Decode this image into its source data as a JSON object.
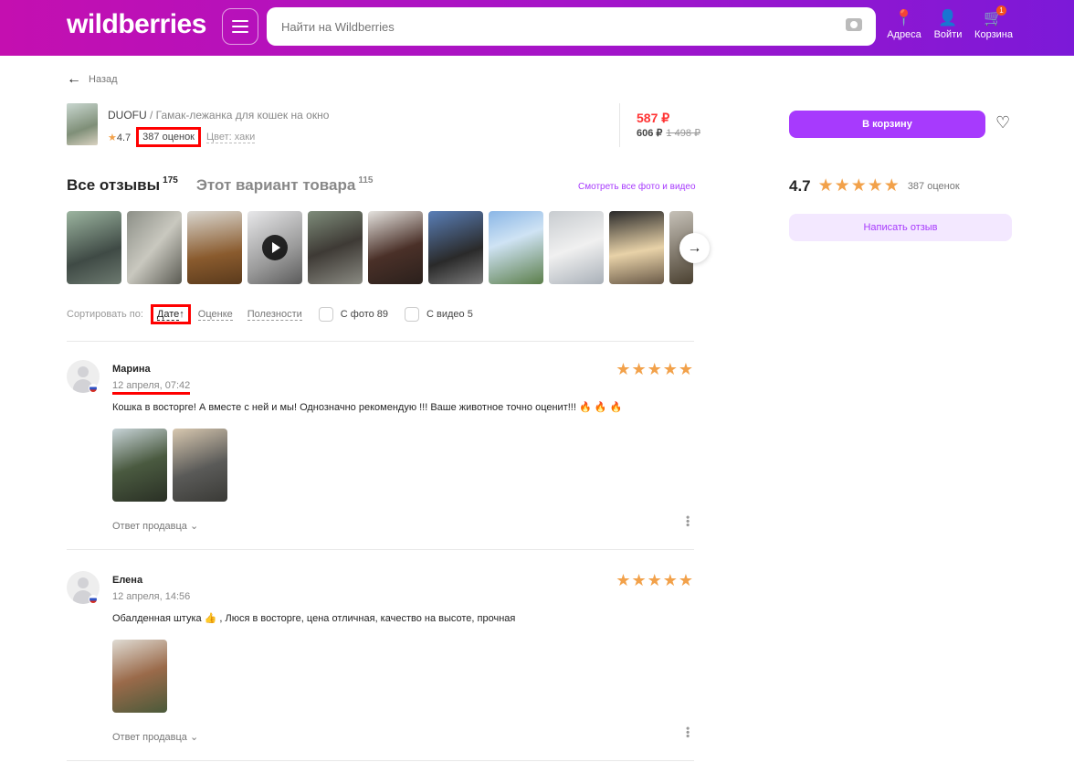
{
  "header": {
    "logo": "wildberries",
    "search_placeholder": "Найти на Wildberries",
    "address": "Адреса",
    "login": "Войти",
    "cart": "Корзина",
    "cart_count": "1"
  },
  "back": "Назад",
  "product": {
    "brand": "DUOFU",
    "name": " / Гамак-лежанка для кошек на окно",
    "rating": "4.7",
    "ratings_count": "387 оценок",
    "color": "Цвет: хаки",
    "price": "587 ₽",
    "price_wallet": "606 ₽",
    "price_old": "1 498 ₽"
  },
  "tabs": [
    {
      "label": "Все отзывы",
      "count": "175"
    },
    {
      "label": "Этот вариант товара",
      "count": "115"
    }
  ],
  "all_photos_link": "Смотреть все фото и видео",
  "sort": {
    "label": "Сортировать по:",
    "options": [
      "Дате",
      "Оценке",
      "Полезности"
    ],
    "active_arrow": "↑",
    "with_photo": "С фото 89",
    "with_video": "С видео 5"
  },
  "reviews": [
    {
      "name": "Марина",
      "date": "12 апреля, 07:42",
      "stars": 5,
      "text": "Кошка в восторге! А вместе с ней и мы! Однозначно рекомендую !!! Ваше животное точно оценит!!! 🔥 🔥 🔥",
      "seller_reply": "Ответ продавца ⌄"
    },
    {
      "name": "Елена",
      "date": "12 апреля, 14:56",
      "stars": 5,
      "text": "Обалденная штука 👍 , Люся в восторге, цена отличная, качество на высоте, прочная",
      "seller_reply": "Ответ продавца ⌄"
    }
  ],
  "sidebar": {
    "add_to_cart": "В корзину",
    "rating": "4.7",
    "ratings_count": "387 оценок",
    "write_review": "Написать отзыв"
  },
  "colors": {
    "accent": "#a73afd",
    "price": "#ff3333",
    "star": "#f2a14a"
  }
}
